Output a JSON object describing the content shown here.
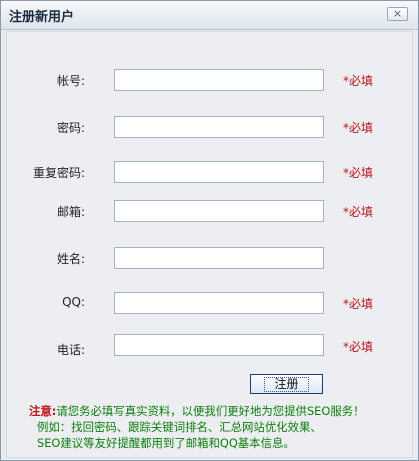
{
  "window": {
    "title": "注册新用户",
    "close_glyph": "×"
  },
  "form": {
    "fields": [
      {
        "key": "account",
        "label": "帐号:",
        "value": "",
        "required": "*必填"
      },
      {
        "key": "password",
        "label": "密码:",
        "value": "",
        "required": "*必填"
      },
      {
        "key": "confirm",
        "label": "重复密码:",
        "value": "",
        "required": "*必填"
      },
      {
        "key": "email",
        "label": "邮箱:",
        "value": "",
        "required": "*必填"
      },
      {
        "key": "name",
        "label": "姓名:",
        "value": ""
      },
      {
        "key": "qq",
        "label": "QQ:",
        "value": "",
        "required": "*必填"
      },
      {
        "key": "phone",
        "label": "电话:",
        "value": "",
        "required": "*必填"
      }
    ],
    "submit_label": "注册"
  },
  "notice": {
    "label": "注意:",
    "line1": "请您务必填写真实资料，以便我们更好地为您提供SEO服务！",
    "line2": "例如：找回密码、跟踪关键词排名、汇总网站优化效果、",
    "line3": "SEO建议等友好提醒都用到了邮箱和QQ基本信息。"
  },
  "colors": {
    "required": "#c8101a",
    "notice_text": "#0a7f0a",
    "background": "#edeef2"
  }
}
